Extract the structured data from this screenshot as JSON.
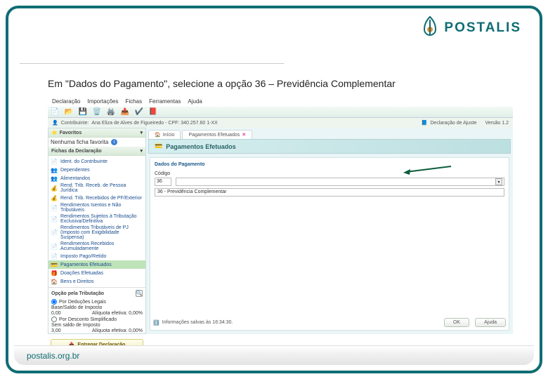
{
  "brand": {
    "name": "POSTALIS",
    "url": "postalis.org.br"
  },
  "instruction": "Em \"Dados do Pagamento\", selecione a opção 36 – Previdência Complementar",
  "menu": {
    "items": [
      "Declaração",
      "Importações",
      "Fichas",
      "Ferramentas",
      "Ajuda"
    ]
  },
  "statusbar": {
    "contribuinte_label": "Contribuinte:",
    "contribuinte": "Ana Eliza de Alves de Figueiredo - CPF: 340.257.60 1-XX",
    "tipo": "Declaração de Ajuste",
    "versao": "Versão 1.2"
  },
  "sidebar": {
    "favoritos_title": "Favoritos",
    "nenhuma": "Nenhuma ficha favorita",
    "fichas_title": "Fichas da Declaração",
    "items": [
      {
        "label": "Ident. do Contribuinte"
      },
      {
        "label": "Dependentes"
      },
      {
        "label": "Alimentandos"
      },
      {
        "label": "Rend. Trib. Receb. de Pessoa Jurídica"
      },
      {
        "label": "Rend. Trib. Recebidos de PF/Exterior"
      },
      {
        "label": "Rendimentos Isentos e Não Tributáveis"
      },
      {
        "label": "Rendimentos Sujeitos à Tributação Exclusiva/Definitiva"
      },
      {
        "label": "Rendimentos Tributáveis de PJ (Imposto com Exigibilidade Suspensa)"
      },
      {
        "label": "Rendimentos Recebidos Acumuladamente"
      },
      {
        "label": "Imposto Pago/Retido"
      },
      {
        "label": "Pagamentos Efetuados"
      },
      {
        "label": "Doações Efetuadas"
      },
      {
        "label": "Bens e Direitos"
      }
    ],
    "opcao": {
      "title": "Opção pela Tributação",
      "op1": "Por Deduções Legais",
      "bs_label": "Base/Saldo de Imposto",
      "bs_val": "0,00",
      "aliq1": "Alíquota efetiva: 0,00%",
      "op2": "Por Desconto Simplificado",
      "ss_label": "Sem saldo de Imposto",
      "ss_val": "3,00",
      "aliq2": "Alíquota efetiva: 0,00%"
    },
    "entregar": "Entregar Declaração"
  },
  "main": {
    "tabs": [
      {
        "label": "Início"
      },
      {
        "label": "Pagamentos Efetuados"
      }
    ],
    "panel_title": "Pagamentos Efetuados",
    "dados_label": "Dados do Pagamento",
    "codigo_label": "Código",
    "codigo_val": "36",
    "select_val": "",
    "desc_val": "36 - Previdência Complementar"
  },
  "footer_app": {
    "info": "Informações salvas às 16:34:30.",
    "ok": "OK",
    "ajuda": "Ajuda"
  }
}
